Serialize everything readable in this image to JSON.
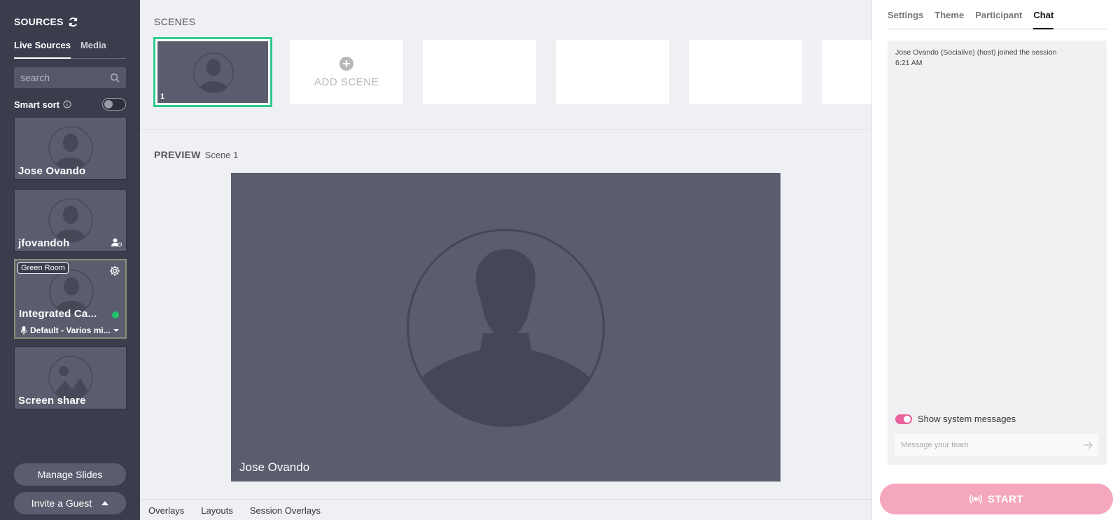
{
  "sidebar": {
    "title": "SOURCES",
    "tabs": [
      "Live Sources",
      "Media"
    ],
    "search_placeholder": "search",
    "smart_sort_label": "Smart sort",
    "sources": [
      {
        "name": "Jose Ovando"
      },
      {
        "name": "jfovandoh"
      },
      {
        "name": "Integrated Ca...",
        "badge": "Green Room",
        "mic": "Default - Varios mi..."
      },
      {
        "name": "Screen share"
      }
    ],
    "manage_slides": "Manage Slides",
    "invite_guest": "Invite a Guest"
  },
  "scenes": {
    "label": "SCENES",
    "selected_number": "1",
    "add_label": "ADD SCENE"
  },
  "preview": {
    "label": "PREVIEW",
    "scene_name": "Scene 1",
    "participant_name": "Jose Ovando"
  },
  "bottom_tabs": [
    "Overlays",
    "Layouts",
    "Session Overlays"
  ],
  "right_panel": {
    "tabs": [
      "Settings",
      "Theme",
      "Participant",
      "Chat"
    ],
    "active_tab": "Chat",
    "chat_message": "Jose Ovando (Socialive) (host) joined the session 6:21 AM",
    "show_system_label": "Show system messages",
    "input_placeholder": "Message your team",
    "start_label": "START"
  },
  "colors": {
    "sidebar_bg": "#3a3d4c",
    "card_bg": "#5a5d6e",
    "selected_scene_border": "#2ecc8e",
    "toggle_on": "#e9639c",
    "start_button": "#f5a7bd",
    "live_dot": "#22c26a"
  }
}
